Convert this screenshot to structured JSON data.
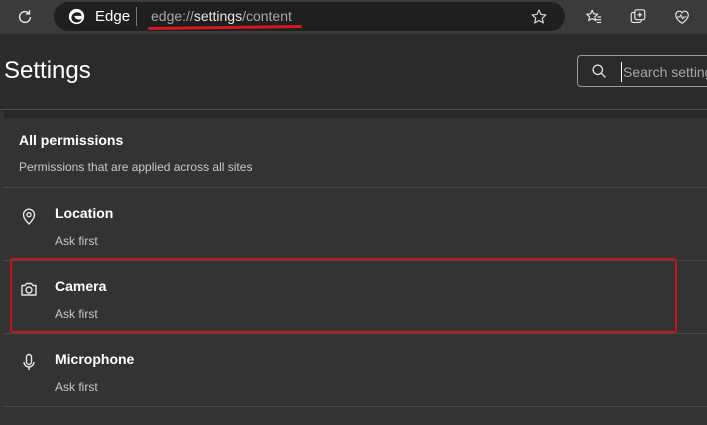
{
  "browser": {
    "site_name": "Edge",
    "url_scheme": "edge://",
    "url_host": "settings",
    "url_path": "/content",
    "colors": {
      "accent_red": "#c8141a",
      "toolbar": "#3b3b3b",
      "background": "#282828"
    }
  },
  "header": {
    "title": "Settings",
    "search_placeholder": "Search settings"
  },
  "section": {
    "title": "All permissions",
    "description": "Permissions that are applied across all sites"
  },
  "permissions": [
    {
      "label": "Location",
      "status": "Ask first",
      "icon": "location-pin-icon"
    },
    {
      "label": "Camera",
      "status": "Ask first",
      "icon": "camera-icon"
    },
    {
      "label": "Microphone",
      "status": "Ask first",
      "icon": "microphone-icon"
    }
  ]
}
